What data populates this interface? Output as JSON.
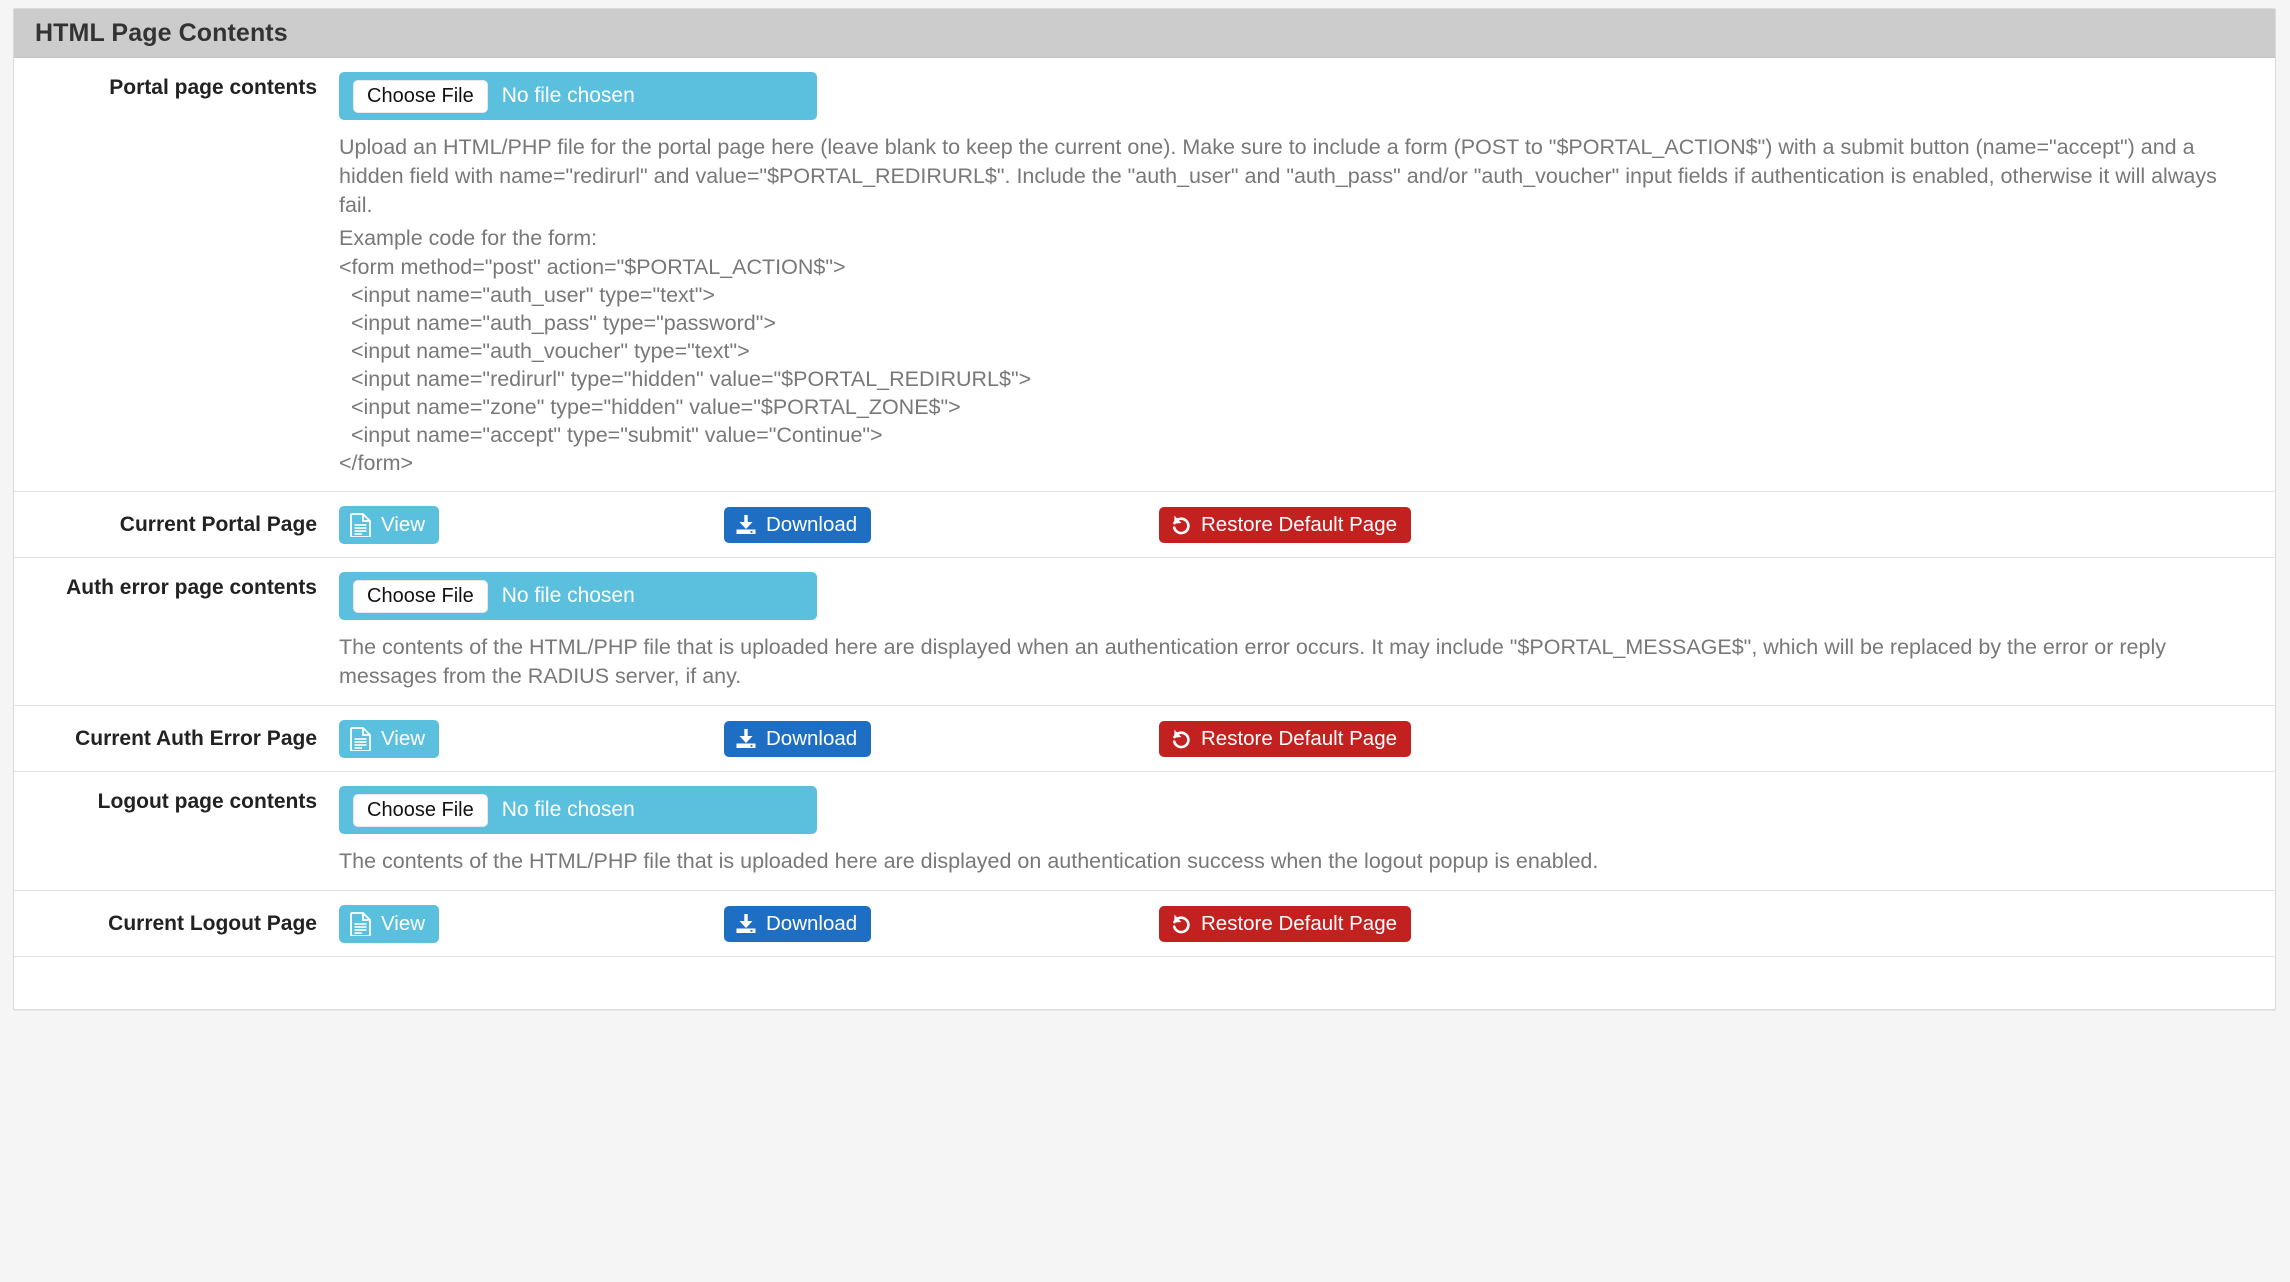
{
  "panel": {
    "title": "HTML Page Contents"
  },
  "file_input": {
    "button_label": "Choose File",
    "status_text": "No file chosen"
  },
  "actions": {
    "view_label": "View",
    "download_label": "Download",
    "restore_label": "Restore Default Page",
    "view_icon": "file-document-icon",
    "download_icon": "download-icon",
    "restore_icon": "undo-rotate-left-icon"
  },
  "colors": {
    "panel_heading_bg": "#cccccc",
    "info": "#5BC0DE",
    "primary": "#1E6FC4",
    "danger": "#C32020",
    "help_text": "#787878"
  },
  "rows": {
    "portal_page_contents": {
      "label": "Portal page contents",
      "help_paragraph": "Upload an HTML/PHP file for the portal page here (leave blank to keep the current one). Make sure to include a form (POST to \"$PORTAL_ACTION$\") with a submit button (name=\"accept\") and a hidden field with name=\"redirurl\" and value=\"$PORTAL_REDIRURL$\". Include the \"auth_user\" and \"auth_pass\" and/or \"auth_voucher\" input fields if authentication is enabled, otherwise it will always fail.",
      "example_heading": "Example code for the form:",
      "example_code": "<form method=\"post\" action=\"$PORTAL_ACTION$\">\n  <input name=\"auth_user\" type=\"text\">\n  <input name=\"auth_pass\" type=\"password\">\n  <input name=\"auth_voucher\" type=\"text\">\n  <input name=\"redirurl\" type=\"hidden\" value=\"$PORTAL_REDIRURL$\">\n  <input name=\"zone\" type=\"hidden\" value=\"$PORTAL_ZONE$\">\n  <input name=\"accept\" type=\"submit\" value=\"Continue\">\n</form>"
    },
    "current_portal_page": {
      "label": "Current Portal Page"
    },
    "auth_error_page_contents": {
      "label": "Auth error page contents",
      "help_paragraph": "The contents of the HTML/PHP file that is uploaded here are displayed when an authentication error occurs. It may include \"$PORTAL_MESSAGE$\", which will be replaced by the error or reply messages from the RADIUS server, if any."
    },
    "current_auth_error_page": {
      "label": "Current Auth Error Page"
    },
    "logout_page_contents": {
      "label": "Logout page contents",
      "help_paragraph": "The contents of the HTML/PHP file that is uploaded here are displayed on authentication success when the logout popup is enabled."
    },
    "current_logout_page": {
      "label": "Current Logout Page"
    }
  }
}
